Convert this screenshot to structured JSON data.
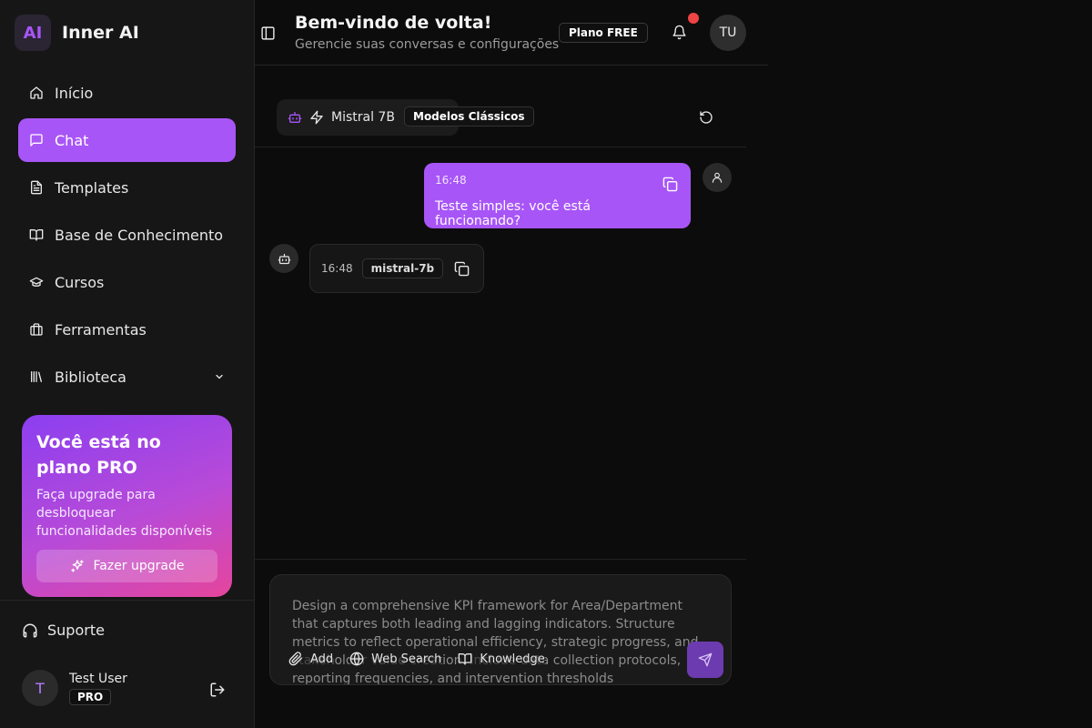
{
  "brand": {
    "logo": "AI",
    "name": "Inner AI"
  },
  "sidebar": {
    "items": [
      {
        "label": "Início",
        "icon": "home-icon"
      },
      {
        "label": "Chat",
        "icon": "message-icon",
        "active": true
      },
      {
        "label": "Templates",
        "icon": "document-icon"
      },
      {
        "label": "Base de Conhecimento",
        "icon": "book-icon"
      },
      {
        "label": "Cursos",
        "icon": "graduation-cap-icon"
      },
      {
        "label": "Ferramentas",
        "icon": "briefcase-icon"
      },
      {
        "label": "Biblioteca",
        "icon": "library-icon",
        "expandable": true
      }
    ],
    "promo": {
      "title": "Você está no plano PRO",
      "description": "Faça upgrade para desbloquear funcionalidades disponíveis",
      "button": "Fazer upgrade"
    },
    "support": "Suporte",
    "user": {
      "initial": "T",
      "name": "Test User",
      "badge": "PRO"
    }
  },
  "header": {
    "title": "Bem-vindo de volta!",
    "subtitle": "Gerencie suas conversas e configurações",
    "plan_badge": "Plano FREE",
    "avatar": "TU"
  },
  "model_bar": {
    "model_name": "Mistral 7B",
    "category": "Modelos Clássicos"
  },
  "messages": [
    {
      "role": "user",
      "time": "16:48",
      "text": "Teste simples: você está funcionando?"
    },
    {
      "role": "assistant",
      "time": "16:48",
      "model": "mistral-7b",
      "text": ""
    }
  ],
  "composer": {
    "text": "Design a comprehensive KPI framework for Area/Department that captures both leading and lagging indicators. Structure metrics to reflect operational efficiency, strategic progress, and stakeholder value creation. Include data collection protocols, reporting frequencies, and intervention thresholds",
    "tools": {
      "add": "Add",
      "web_search": "Web Search",
      "knowledge": "Knowledge"
    }
  },
  "colors": {
    "accent": "#a855f7",
    "notification": "#ef4444",
    "background": "#0c0c0c",
    "sidebar": "#161616"
  }
}
